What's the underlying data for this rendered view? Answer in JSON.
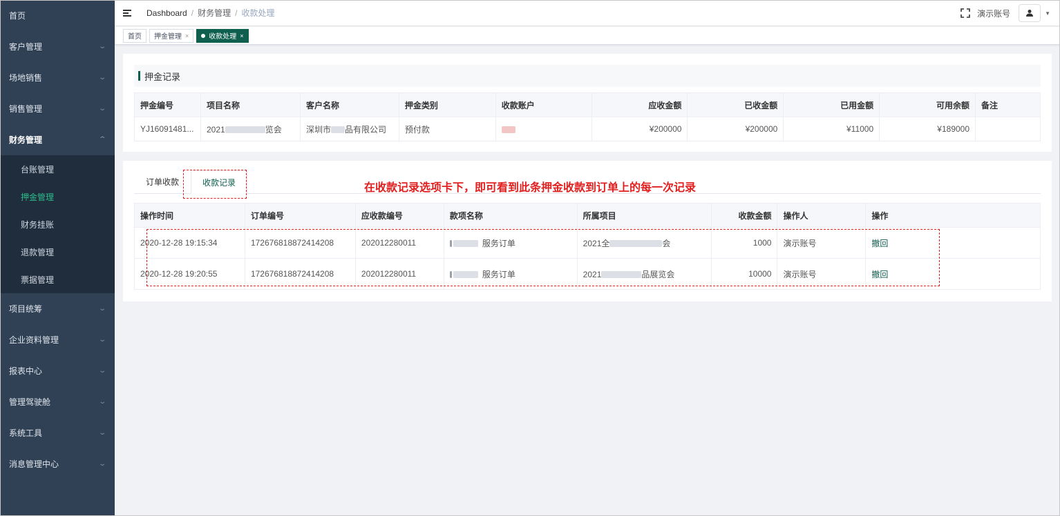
{
  "sidebar": {
    "items": [
      {
        "label": "首页",
        "has_children": false
      },
      {
        "label": "客户管理",
        "has_children": true
      },
      {
        "label": "场地销售",
        "has_children": true
      },
      {
        "label": "销售管理",
        "has_children": true
      },
      {
        "label": "财务管理",
        "has_children": true,
        "expanded": true
      },
      {
        "label": "项目统筹",
        "has_children": true
      },
      {
        "label": "企业资料管理",
        "has_children": true
      },
      {
        "label": "报表中心",
        "has_children": true
      },
      {
        "label": "管理驾驶舱",
        "has_children": true
      },
      {
        "label": "系统工具",
        "has_children": true
      },
      {
        "label": "消息管理中心",
        "has_children": true
      }
    ],
    "finance_sub": [
      {
        "label": "台账管理"
      },
      {
        "label": "押金管理",
        "active": true
      },
      {
        "label": "财务挂账"
      },
      {
        "label": "退款管理"
      },
      {
        "label": "票据管理"
      }
    ]
  },
  "header": {
    "breadcrumb": [
      "Dashboard",
      "财务管理",
      "收款处理"
    ],
    "breadcrumb_sep": "/",
    "account_name": "演示账号"
  },
  "tags": [
    {
      "label": "首页",
      "closable": false,
      "active": false
    },
    {
      "label": "押金管理",
      "closable": true,
      "active": false
    },
    {
      "label": "收款处理",
      "closable": true,
      "active": true
    }
  ],
  "deposit": {
    "section_title": "押金记录",
    "columns": [
      "押金编号",
      "项目名称",
      "客户名称",
      "押金类别",
      "收款账户",
      "应收金额",
      "已收金额",
      "已用金额",
      "可用余额",
      "备注"
    ],
    "row": {
      "id": "YJ16091481...",
      "project_prefix": "2021",
      "project_suffix": "览会",
      "customer_prefix": "深圳市",
      "customer_suffix": "品有限公司",
      "type": "预付款",
      "receivable": "¥200000",
      "received": "¥200000",
      "used": "¥11000",
      "available": "¥189000",
      "note": ""
    }
  },
  "records": {
    "tabs": [
      {
        "label": "订单收款",
        "active": false
      },
      {
        "label": "收款记录",
        "active": true
      }
    ],
    "annotation": "在收款记录选项卡下，即可看到此条押金收款到订单上的每一次记录",
    "columns": [
      "操作时间",
      "订单编号",
      "应收款编号",
      "款项名称",
      "所属项目",
      "收款金额",
      "操作人",
      "操作"
    ],
    "rows": [
      {
        "time": "2020-12-28 19:15:34",
        "order_no": "172676818872414208",
        "receivable_no": "202012280011",
        "item_suffix": "服务订单",
        "project_prefix": "2021全",
        "project_suffix": "会",
        "amount": "1000",
        "operator": "演示账号",
        "action": "撤回"
      },
      {
        "time": "2020-12-28 19:20:55",
        "order_no": "172676818872414208",
        "receivable_no": "202012280011",
        "item_suffix": "服务订单",
        "project_prefix": "2021",
        "project_suffix": "品展览会",
        "amount": "10000",
        "operator": "演示账号",
        "action": "撤回"
      }
    ]
  },
  "colors": {
    "accent": "#0f5f4f",
    "sidebar_bg": "#304156",
    "annotation": "#e02020"
  }
}
